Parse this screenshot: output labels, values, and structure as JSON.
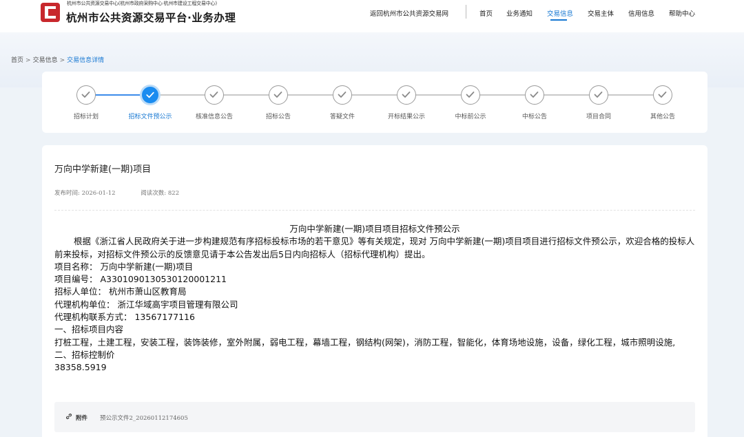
{
  "header": {
    "org_line": "杭州市公共资源交易中心(杭州市政府采购中心·杭州市建设工程交易中心)",
    "site_title": "杭州市公共资源交易平台·业务办理",
    "nav": {
      "back_link": "返回杭州市公共资源交易网",
      "items": [
        "首页",
        "业务通知",
        "交易信息",
        "交易主体",
        "信用信息",
        "帮助中心"
      ],
      "active": "交易信息"
    },
    "brand_color": "#c8282d",
    "accent_color": "#1677d2"
  },
  "breadcrumb": {
    "home": "首页",
    "sep": ">",
    "section": "交易信息",
    "current": "交易信息详情"
  },
  "steps": {
    "items": [
      "招标计划",
      "招标文件预公示",
      "核准信息公告",
      "招标公告",
      "答疑文件",
      "开标结果公示",
      "中标前公示",
      "中标公告",
      "项目合同",
      "其他公告"
    ],
    "active_index": 1
  },
  "article": {
    "title": "万向中学新建(一期)项目",
    "publish_label": "发布时间:",
    "publish_date": "2026-01-12",
    "views_label": "阅读次数:",
    "views": "822",
    "heading": "万向中学新建(一期)项目项目招标文件预公示",
    "intro": "根据《浙江省人民政府关于进一步构建规范有序招标投标市场的若干意见》等有关规定，现对 万向中学新建(一期)项目项目进行招标文件预公示，欢迎合格的投标人前来投标，对招标文件预公示的反馈意见请于本公告发出后5日内向招标人（招标代理机构）提出。",
    "project_name": "项目名称： 万向中学新建(一期)项目",
    "project_code": "项目编号： A3301090130530120001211",
    "tenderer": "招标人单位： 杭州市萧山区教育局",
    "agency": "代理机构单位： 浙江华域高宇项目管理有限公司",
    "agency_contact": "代理机构联系方式： 13567177116",
    "section1_title": "一、招标项目内容",
    "section1_body": "打桩工程，土建工程，安装工程，装饰装修，室外附属，弱电工程，幕墙工程，钢结构(网架)，消防工程，智能化，体育场地设施，设备，绿化工程，城市照明设施,",
    "section2_title": "二、招标控制价",
    "control_price": "38358.5919"
  },
  "attachment": {
    "icon": "link-icon",
    "label": "附件",
    "file_name": "预公示文件2_20260112174605"
  }
}
